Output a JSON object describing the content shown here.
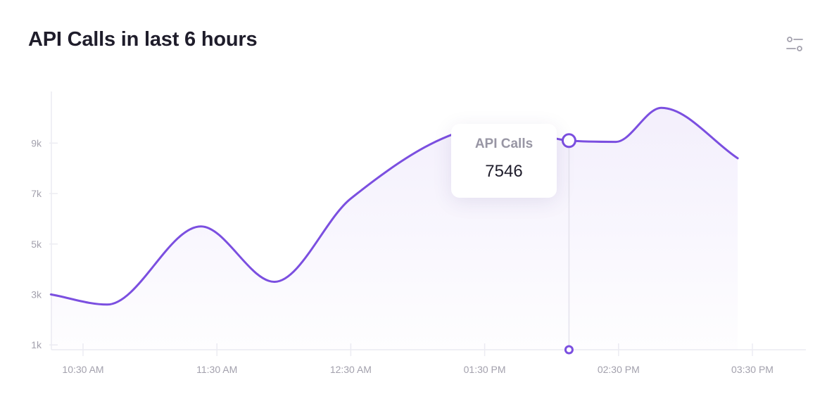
{
  "title": "API Calls in last 6 hours",
  "settings_icon": "sliders-icon",
  "colors": {
    "accent": "#7b4fe0",
    "grid": "#ececf2",
    "tick_text": "#a3a1ad"
  },
  "tooltip": {
    "label": "API Calls",
    "value": "7546"
  },
  "chart_data": {
    "type": "area",
    "ylim": [
      0,
      10000
    ],
    "yticks": [
      1000,
      3000,
      5000,
      7000,
      9000
    ],
    "ytick_labels": [
      "1k",
      "3k",
      "5k",
      "7k",
      "9k"
    ],
    "xticks": [
      0,
      1,
      2,
      3,
      4,
      5
    ],
    "xtick_labels": [
      "10:30 AM",
      "11:30 AM",
      "12:30 AM",
      "01:30 PM",
      "02:30 PM",
      "03:30 PM"
    ],
    "series": [
      {
        "x": [
          -0.24,
          0.18,
          0.88,
          1.43,
          2.0,
          3.1,
          3.63,
          3.98,
          4.32,
          4.89
        ],
        "values": [
          3000,
          2600,
          5700,
          3500,
          6800,
          9700,
          9100,
          9050,
          10400,
          8400
        ]
      }
    ],
    "hover": {
      "x": 3.63,
      "value": 7546
    }
  }
}
